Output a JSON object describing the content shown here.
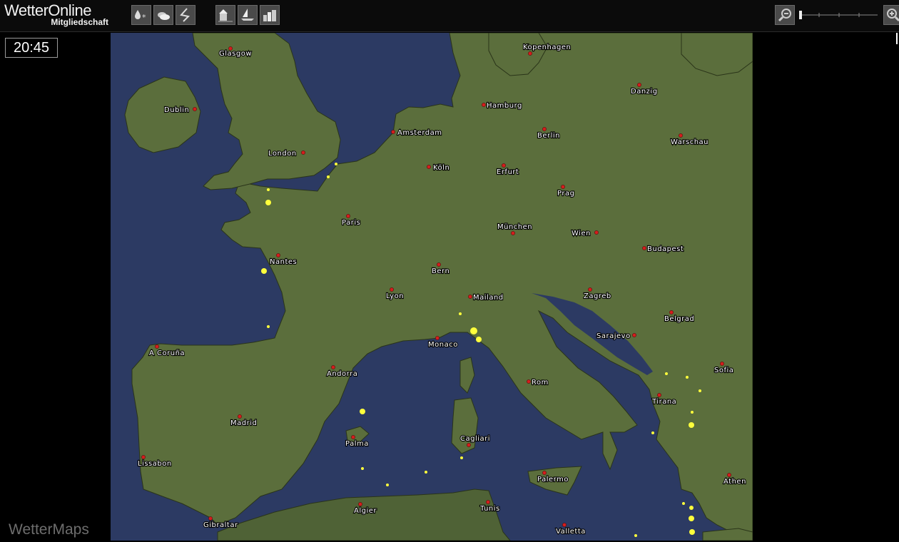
{
  "header": {
    "brand": "WetterOnline",
    "subtitle": "Mitgliedschaft"
  },
  "toolbar": {
    "buttons": [
      {
        "name": "precip-icon"
      },
      {
        "name": "clouds-icon"
      },
      {
        "name": "wind-icon"
      },
      {
        "name": "coast-icon"
      },
      {
        "name": "sea-icon"
      },
      {
        "name": "city-icon"
      }
    ],
    "zoom_level": 0
  },
  "clock": "20:45",
  "footer": "WetterMaps",
  "colors": {
    "sea": "#2c3a63",
    "land": "#5b6e3c",
    "border": "#1b1f12",
    "city": "#d61d1d",
    "lightning": "#ffff3c"
  },
  "map": {
    "cities": [
      {
        "name": "Glasgow"
      },
      {
        "name": "Kopenhagen"
      },
      {
        "name": "Danzig"
      },
      {
        "name": "Dublin"
      },
      {
        "name": "Hamburg"
      },
      {
        "name": "Amsterdam"
      },
      {
        "name": "Berlin"
      },
      {
        "name": "Warschau"
      },
      {
        "name": "London"
      },
      {
        "name": "Köln"
      },
      {
        "name": "Erfurt"
      },
      {
        "name": "Prag"
      },
      {
        "name": "Paris"
      },
      {
        "name": "München"
      },
      {
        "name": "Wien"
      },
      {
        "name": "Budapest"
      },
      {
        "name": "Nantes"
      },
      {
        "name": "Bern"
      },
      {
        "name": "Lyon"
      },
      {
        "name": "Mailand"
      },
      {
        "name": "Zagreb"
      },
      {
        "name": "Belgrad"
      },
      {
        "name": "Sarajevo"
      },
      {
        "name": "A Coruña"
      },
      {
        "name": "Monaco"
      },
      {
        "name": "Andorra"
      },
      {
        "name": "Sofia"
      },
      {
        "name": "Rom"
      },
      {
        "name": "Tirana"
      },
      {
        "name": "Madrid"
      },
      {
        "name": "Palma"
      },
      {
        "name": "Cagliari"
      },
      {
        "name": "Lissabon"
      },
      {
        "name": "Palermo"
      },
      {
        "name": "Athen"
      },
      {
        "name": "Algier"
      },
      {
        "name": "Tunis"
      },
      {
        "name": "Gibraltar"
      },
      {
        "name": "Valletta"
      }
    ]
  }
}
